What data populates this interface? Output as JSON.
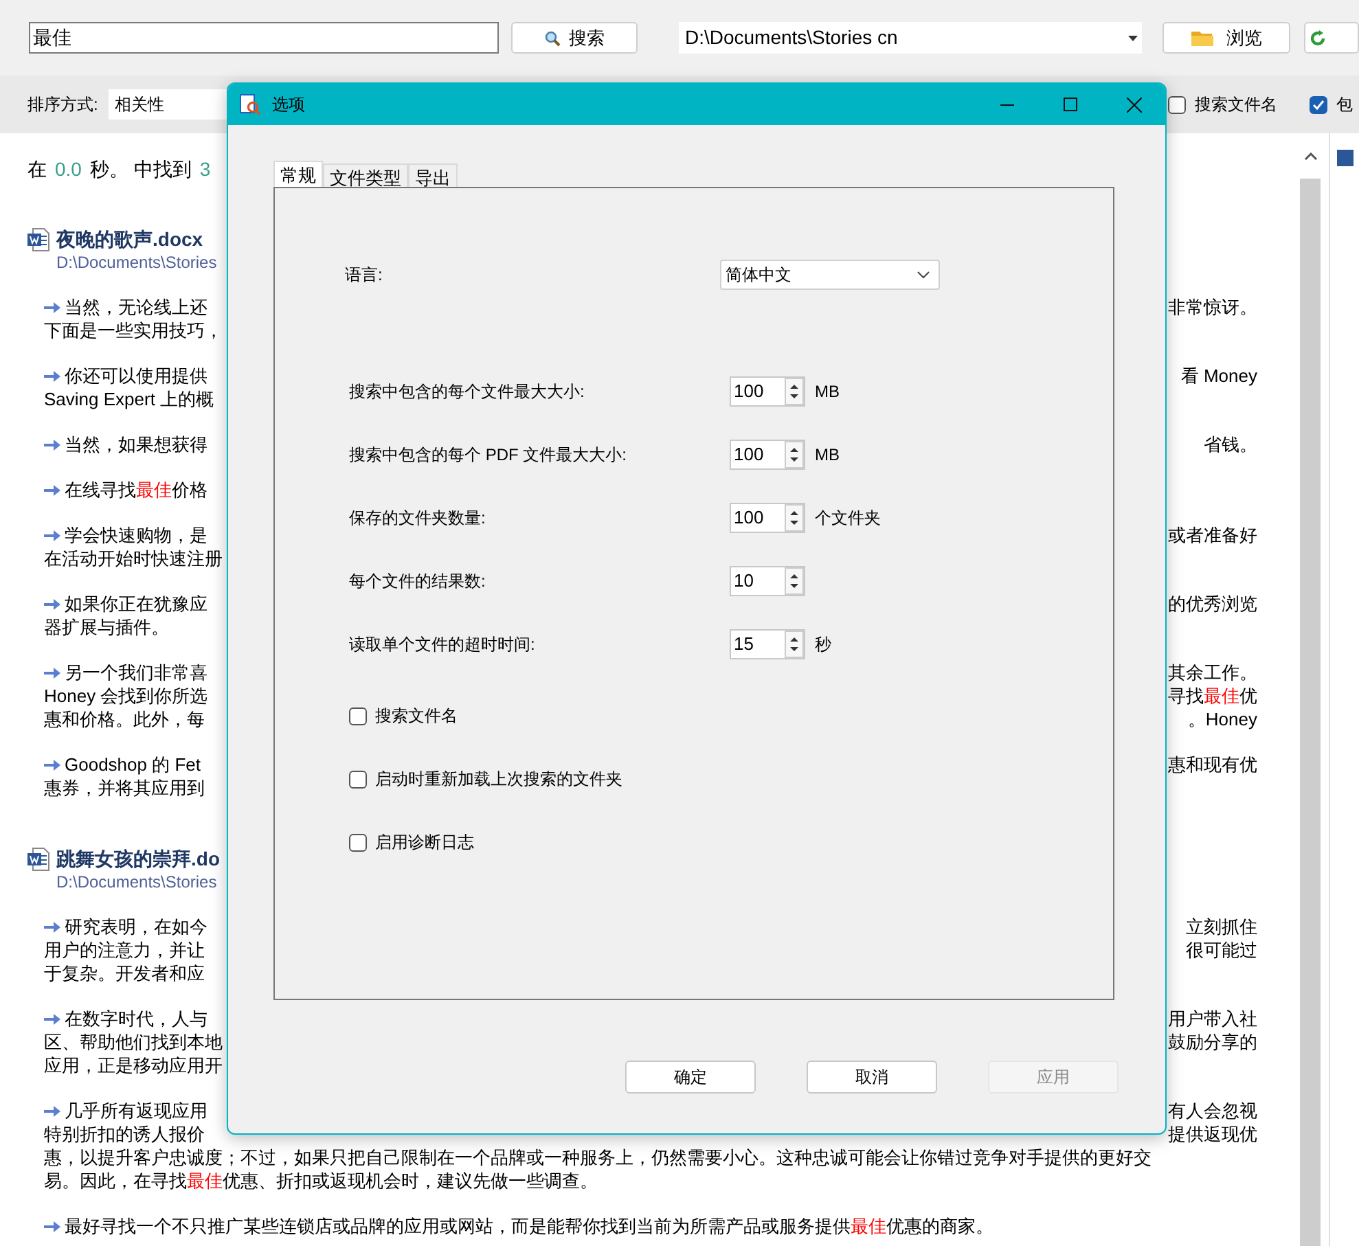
{
  "search": {
    "value": "最佳",
    "button": "搜索"
  },
  "folder": {
    "value": "D:\\Documents\\Stories cn",
    "browse_button": "浏览"
  },
  "sort": {
    "label": "排序方式:",
    "value": "相关性"
  },
  "filters": [
    {
      "label": "搜索文件名",
      "checked": false
    },
    {
      "label": "包",
      "checked": true
    }
  ],
  "summary": [
    {
      "text": "在",
      "highlight": false
    },
    {
      "text": "0.0",
      "highlight": true
    },
    {
      "text": "秒。 中找到",
      "highlight": false
    },
    {
      "text": "3",
      "highlight": true
    }
  ],
  "results": [
    {
      "title": "夜晚的歌声.docx",
      "path": "D:\\Documents\\Stories",
      "snippets": [
        {
          "lines": [
            {
              "left": "当然，无论线上还",
              "right": "非常惊讶。"
            },
            {
              "left": "下面是一些实用技巧，"
            }
          ]
        },
        {
          "lines": [
            {
              "left": "你还可以使用提供",
              "right": "看 Money"
            },
            {
              "left": "Saving Expert 上的概"
            }
          ]
        },
        {
          "lines": [
            {
              "left": "当然，如果想获得",
              "right": "省钱。"
            }
          ]
        },
        {
          "lines": [
            {
              "left": [
                {
                  "text": "在线寻找",
                  "hit": false
                },
                {
                  "text": "最佳",
                  "hit": true
                },
                {
                  "text": "价格",
                  "hit": false
                }
              ]
            }
          ]
        },
        {
          "lines": [
            {
              "left": "学会快速购物，是",
              "right": "或者准备好"
            },
            {
              "left": "在活动开始时快速注册"
            }
          ]
        },
        {
          "lines": [
            {
              "left": "如果你正在犹豫应",
              "right": "的优秀浏览"
            },
            {
              "left": "器扩展与插件。"
            }
          ]
        },
        {
          "lines": [
            {
              "left": "另一个我们非常喜",
              "right": "其余工作。"
            },
            {
              "left": "Honey 会找到你所选",
              "right": [
                {
                  "text": "寻找",
                  "hit": false
                },
                {
                  "text": "最佳",
                  "hit": true
                },
                {
                  "text": "优",
                  "hit": false
                }
              ]
            },
            {
              "left": "惠和价格。此外，每",
              "right": "。Honey"
            }
          ]
        },
        {
          "lines": [
            {
              "left": "Goodshop 的 Fet",
              "right": "惠和现有优"
            },
            {
              "left": "惠券，并将其应用到"
            }
          ]
        }
      ]
    },
    {
      "title": "跳舞女孩的崇拜.do",
      "path": "D:\\Documents\\Stories",
      "snippets": [
        {
          "lines": [
            {
              "left": "研究表明，在如今",
              "right": "立刻抓住"
            },
            {
              "left": "用户的注意力，并让",
              "right": "很可能过"
            },
            {
              "left": "于复杂。开发者和应"
            }
          ]
        },
        {
          "lines": [
            {
              "left": "在数字时代，人与",
              "right": "用户带入社"
            },
            {
              "left": "区、帮助他们找到本地",
              "right": "鼓励分享的"
            },
            {
              "left": "应用，正是移动应用开"
            }
          ]
        },
        {
          "lines": [
            {
              "left": "几乎所有返现应用",
              "right": "有人会忽视"
            },
            {
              "left": "特别折扣的诱人报价",
              "right": "提供返现优"
            },
            {
              "left": "惠，以提升客户忠诚度；不过，如果只把自己限制在一个品牌或一种服务上，仍然需要小心。这种忠诚可能会让你错过竞争对手提供的更好交"
            },
            {
              "left": [
                {
                  "text": "易。因此，在寻找",
                  "hit": false
                },
                {
                  "text": "最佳",
                  "hit": true
                },
                {
                  "text": "优惠、折扣或返现机会时，建议先做一些调查。",
                  "hit": false
                }
              ]
            }
          ]
        },
        {
          "lines": [
            {
              "left": [
                {
                  "text": "最好寻找一个不只推广某些连锁店或品牌的应用或网站，而是能帮你找到当前为所需产品或服务提供",
                  "hit": false
                },
                {
                  "text": "最佳",
                  "hit": true
                },
                {
                  "text": "优惠的商家。",
                  "hit": false
                }
              ]
            }
          ]
        }
      ]
    }
  ],
  "dialog": {
    "title": "选项",
    "tabs": [
      {
        "label": "常规",
        "selected": true
      },
      {
        "label": "文件类型",
        "selected": false
      },
      {
        "label": "导出",
        "selected": false
      }
    ],
    "language": {
      "label": "语言:",
      "value": "简体中文"
    },
    "spinners": [
      {
        "label": "搜索中包含的每个文件最大大小:",
        "value": "100",
        "unit": "MB"
      },
      {
        "label": "搜索中包含的每个 PDF 文件最大大小:",
        "value": "100",
        "unit": "MB"
      },
      {
        "label": "保存的文件夹数量:",
        "value": "100",
        "unit": "个文件夹"
      },
      {
        "label": "每个文件的结果数:",
        "value": "10"
      },
      {
        "label": "读取单个文件的超时时间:",
        "value": "15",
        "unit": "秒"
      }
    ],
    "checkboxes": [
      {
        "label": "搜索文件名",
        "checked": false
      },
      {
        "label": "启动时重新加载上次搜索的文件夹",
        "checked": false
      },
      {
        "label": "启用诊断日志",
        "checked": false
      }
    ],
    "buttons": [
      {
        "label": "确定",
        "disabled": false
      },
      {
        "label": "取消",
        "disabled": false
      },
      {
        "label": "应用",
        "disabled": true
      }
    ]
  }
}
